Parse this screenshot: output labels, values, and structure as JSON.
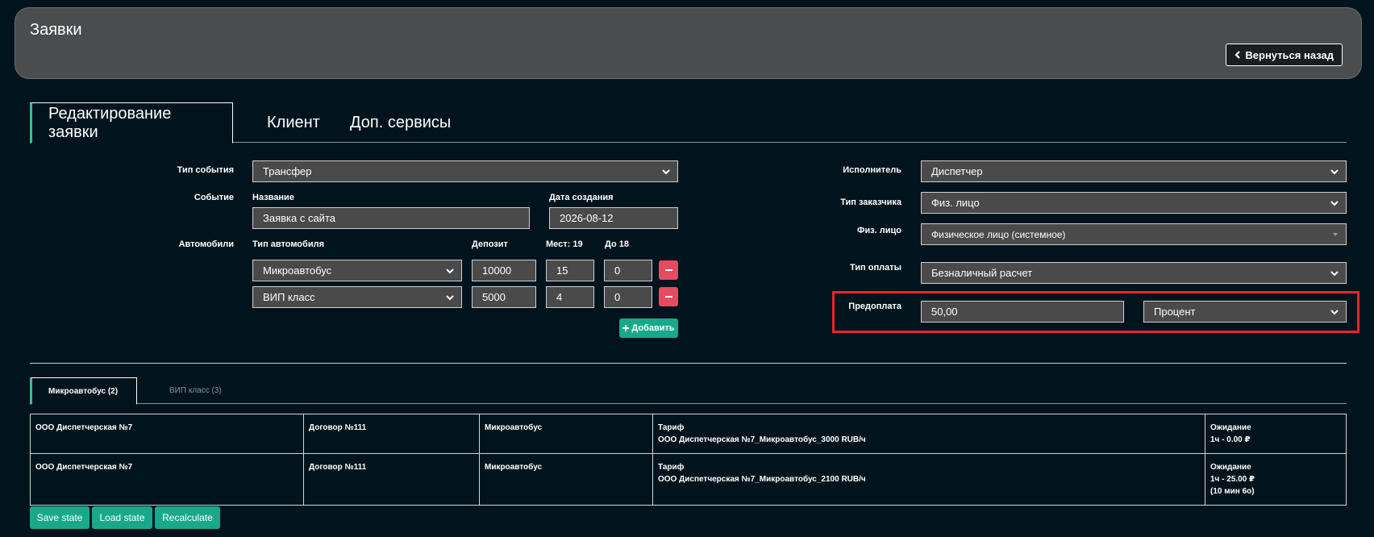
{
  "header": {
    "title": "Заявки",
    "back_label": "Вернуться назад"
  },
  "tabs": [
    {
      "label": "Редактирование заявки",
      "active": true
    },
    {
      "label": "Клиент",
      "active": false
    },
    {
      "label": "Доп. сервисы",
      "active": false
    }
  ],
  "form_left": {
    "event_type_label": "Тип события",
    "event_type_value": "Трансфер",
    "event_label": "Событие",
    "name_label": "Название",
    "name_value": "Заявка с сайта",
    "created_label": "Дата создания",
    "created_value": "2026-08-12",
    "cars_label": "Автомобили",
    "car_type_header": "Тип автомобиля",
    "deposit_header": "Депозит",
    "seats_header": "Мест: 19",
    "under18_header": "До 18",
    "cars": [
      {
        "type": "Микроавтобус",
        "deposit": "10000",
        "seats": "15",
        "under18": "0"
      },
      {
        "type": "ВИП класс",
        "deposit": "5000",
        "seats": "4",
        "under18": "0"
      }
    ],
    "add_label": "Добавить"
  },
  "form_right": {
    "executor_label": "Исполнитель",
    "executor_value": "Диспетчер",
    "customer_type_label": "Тип заказчика",
    "customer_type_value": "Физ. лицо",
    "person_label": "Физ. лицо",
    "person_value": "Физическое лицо (системное)",
    "payment_type_label": "Тип оплаты",
    "payment_type_value": "Безналичный расчет",
    "prepayment_label": "Предоплата",
    "prepayment_value": "50,00",
    "prepayment_unit": "Процент"
  },
  "subtabs": [
    {
      "label": "Микроавтобус (2)",
      "active": true
    },
    {
      "label": "ВИП класс (3)",
      "active": false
    }
  ],
  "rows": [
    {
      "company": "ООО Диспетчерская №7",
      "contract": "Договор №111",
      "car": "Микроавтобус",
      "tariff_title": "Тариф",
      "tariff_value": "ООО Диспетчерская №7_Микроавтобус_3000 RUB/ч",
      "wait_title": "Ожидание",
      "wait_line1": "1ч - 0.00 ₽",
      "wait_line2": ""
    },
    {
      "company": "ООО Диспетчерская №7",
      "contract": "Договор №111",
      "car": "Микроавтобус",
      "tariff_title": "Тариф",
      "tariff_value": "ООО Диспетчерская №7_Микроавтобус_2100 RUB/ч",
      "wait_title": "Ожидание",
      "wait_line1": "1ч - 25.00 ₽",
      "wait_line2": "(10 мин 6о)"
    }
  ],
  "buttons": {
    "save": "Save state",
    "load": "Load state",
    "recalc": "Recalculate"
  },
  "colors": {
    "accent": "#19a98a",
    "danger": "#e84b60",
    "highlight": "#e8242d",
    "background": "#01141d"
  }
}
